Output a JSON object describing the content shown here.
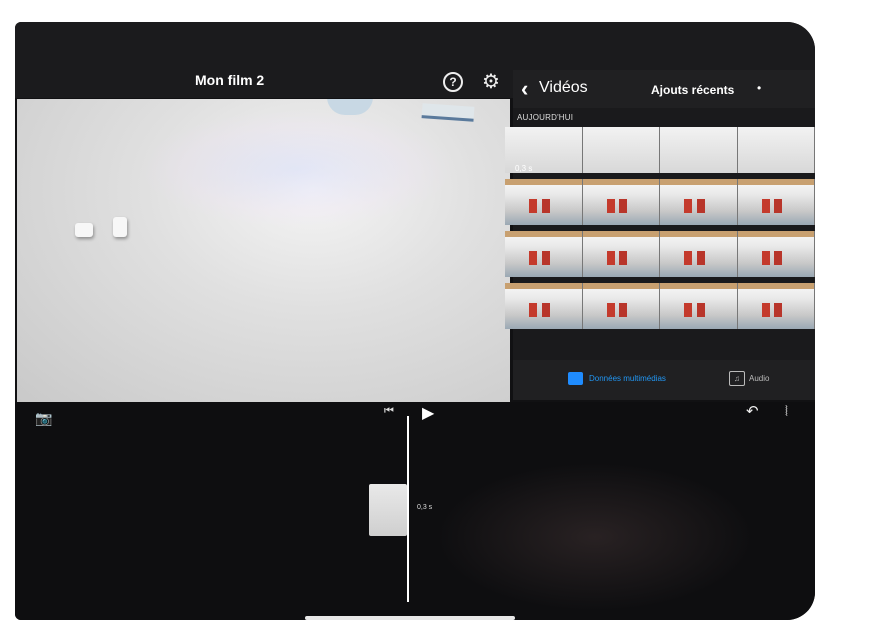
{
  "header": {
    "title": "Mon film 2",
    "help_icon": "help-icon",
    "settings_icon": "gear-icon"
  },
  "browser": {
    "back_label": "Vidéos",
    "title": "Ajouts récents",
    "section_label": "AUJOURD'HUI",
    "first_clip_duration": "0,3 s"
  },
  "tabs": {
    "media_label": "Données multimédias",
    "audio_label": "Audio"
  },
  "timeline": {
    "clip_duration": "0,3 s"
  },
  "colors": {
    "accent": "#2196f3",
    "background": "#111113"
  }
}
